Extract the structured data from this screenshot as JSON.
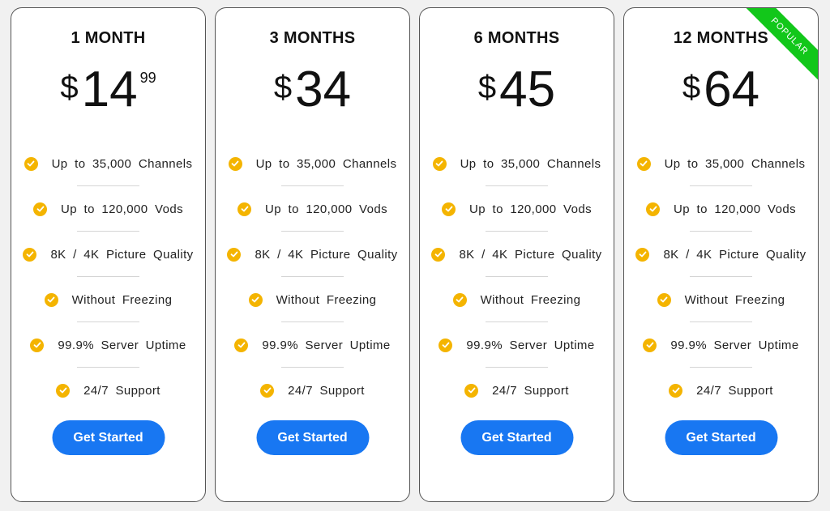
{
  "plans": [
    {
      "name": "1 MONTH",
      "currency": "$",
      "amount": "14",
      "cents": "99",
      "features": [
        "Up to 35,000 Channels",
        "Up to 120,000 Vods",
        "8K / 4K Picture Quality",
        "Without Freezing",
        "99.9% Server Uptime",
        "24/7 Support"
      ],
      "cta": "Get Started"
    },
    {
      "name": "3 MONTHS",
      "currency": "$",
      "amount": "34",
      "features": [
        "Up to 35,000 Channels",
        "Up to 120,000 Vods",
        "8K / 4K Picture Quality",
        "Without Freezing",
        "99.9% Server Uptime",
        "24/7 Support"
      ],
      "cta": "Get Started"
    },
    {
      "name": "6 MONTHS",
      "currency": "$",
      "amount": "45",
      "features": [
        "Up to 35,000 Channels",
        "Up to 120,000 Vods",
        "8K / 4K Picture Quality",
        "Without Freezing",
        "99.9% Server Uptime",
        "24/7 Support"
      ],
      "cta": "Get Started"
    },
    {
      "name": "12 MONTHS",
      "currency": "$",
      "amount": "64",
      "badge": "POPULAR",
      "features": [
        "Up to 35,000 Channels",
        "Up to 120,000 Vods",
        "8K / 4K Picture Quality",
        "Without Freezing",
        "99.9% Server Uptime",
        "24/7 Support"
      ],
      "cta": "Get Started"
    }
  ],
  "colors": {
    "check": "#f4b400",
    "button": "#1877f2",
    "badge": "#12c71a"
  },
  "icons": {
    "feature": "checkmark-circle-icon"
  }
}
